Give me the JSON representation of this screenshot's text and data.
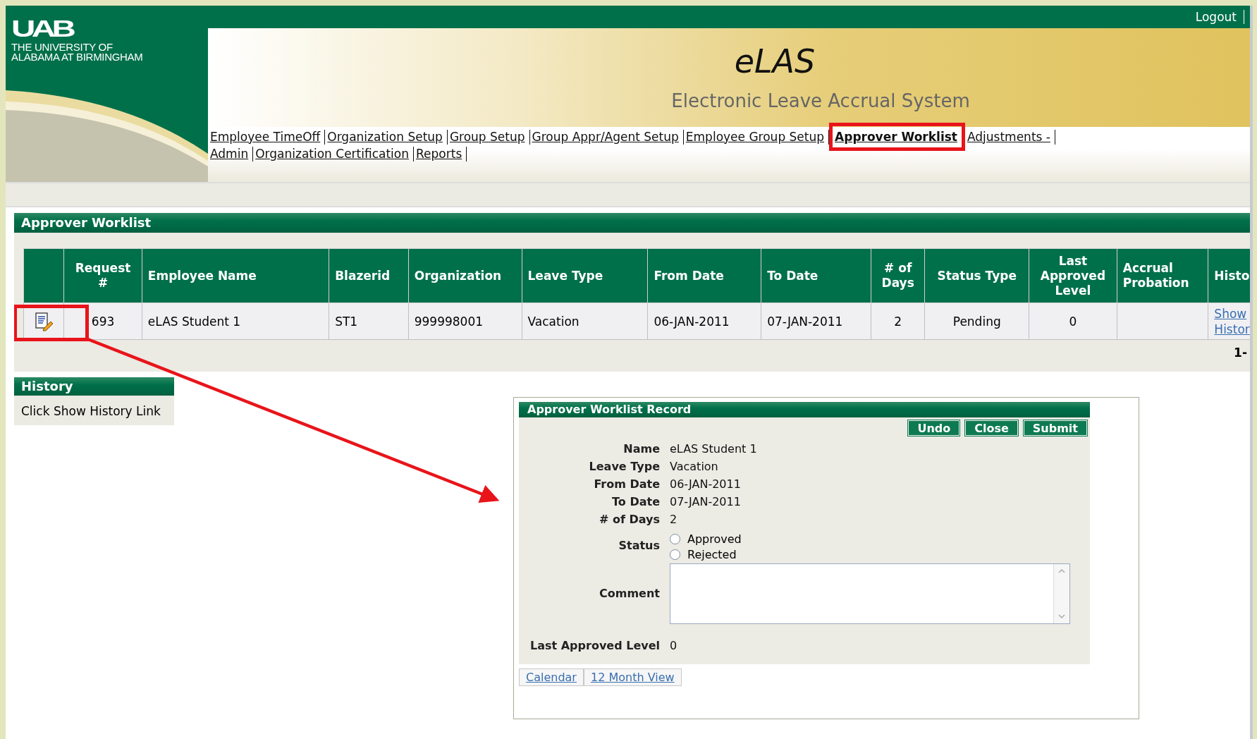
{
  "header": {
    "logo": {
      "mark": "UAB",
      "lines": [
        "THE UNIVERSITY OF",
        "ALABAMA AT BIRMINGHAM"
      ]
    },
    "logout": "Logout",
    "title": "eLAS",
    "subtitle": "Electronic Leave Accrual System"
  },
  "nav": {
    "rows": [
      [
        {
          "label": "Employee TimeOff",
          "selected": false
        },
        {
          "label": "Organization Setup",
          "selected": false
        },
        {
          "label": "Group Setup",
          "selected": false
        },
        {
          "label": "Group Appr/Agent Setup",
          "selected": false
        },
        {
          "label": "Employee Group Setup",
          "selected": false
        },
        {
          "label": "Approver Worklist",
          "selected": true
        },
        {
          "label": "Adjustments -",
          "selected": false
        }
      ],
      [
        {
          "label": "Admin",
          "selected": false
        },
        {
          "label": "Organization Certification",
          "selected": false
        },
        {
          "label": "Reports",
          "selected": false
        }
      ]
    ]
  },
  "worklist": {
    "title": "Approver Worklist",
    "columns": [
      "Request #",
      "Employee Name",
      "Blazerid",
      "Organization",
      "Leave Type",
      "From Date",
      "To Date",
      "# of Days",
      "Status Type",
      "Last Approved Level",
      "Accrual Probation",
      "Histo"
    ],
    "rows": [
      {
        "highlighted": true,
        "cells": [
          "693",
          "eLAS Student 1",
          "ST1",
          "999998001",
          "Vacation",
          "06-JAN-2011",
          "07-JAN-2011",
          "2",
          "Pending",
          "0"
        ],
        "history_link": "Show Histor"
      }
    ],
    "pager": "1-"
  },
  "history": {
    "title": "History",
    "text": "Click Show History Link"
  },
  "record": {
    "title": "Approver Worklist Record",
    "buttons": [
      "Undo",
      "Close",
      "Submit"
    ],
    "fields": [
      {
        "label": "Name",
        "value": "eLAS Student 1"
      },
      {
        "label": "Leave Type",
        "value": "Vacation"
      },
      {
        "label": "From Date",
        "value": "06-JAN-2011"
      },
      {
        "label": "To Date",
        "value": "07-JAN-2011"
      },
      {
        "label": "# of Days",
        "value": "2"
      }
    ],
    "status": {
      "label": "Status",
      "options": [
        {
          "label": "Approved",
          "selected": false
        },
        {
          "label": "Rejected",
          "selected": false
        }
      ]
    },
    "comment": {
      "label": "Comment"
    },
    "last_level": {
      "label": "Last Approved Level",
      "value": "0"
    },
    "links": [
      "Calendar",
      "12 Month View"
    ]
  }
}
